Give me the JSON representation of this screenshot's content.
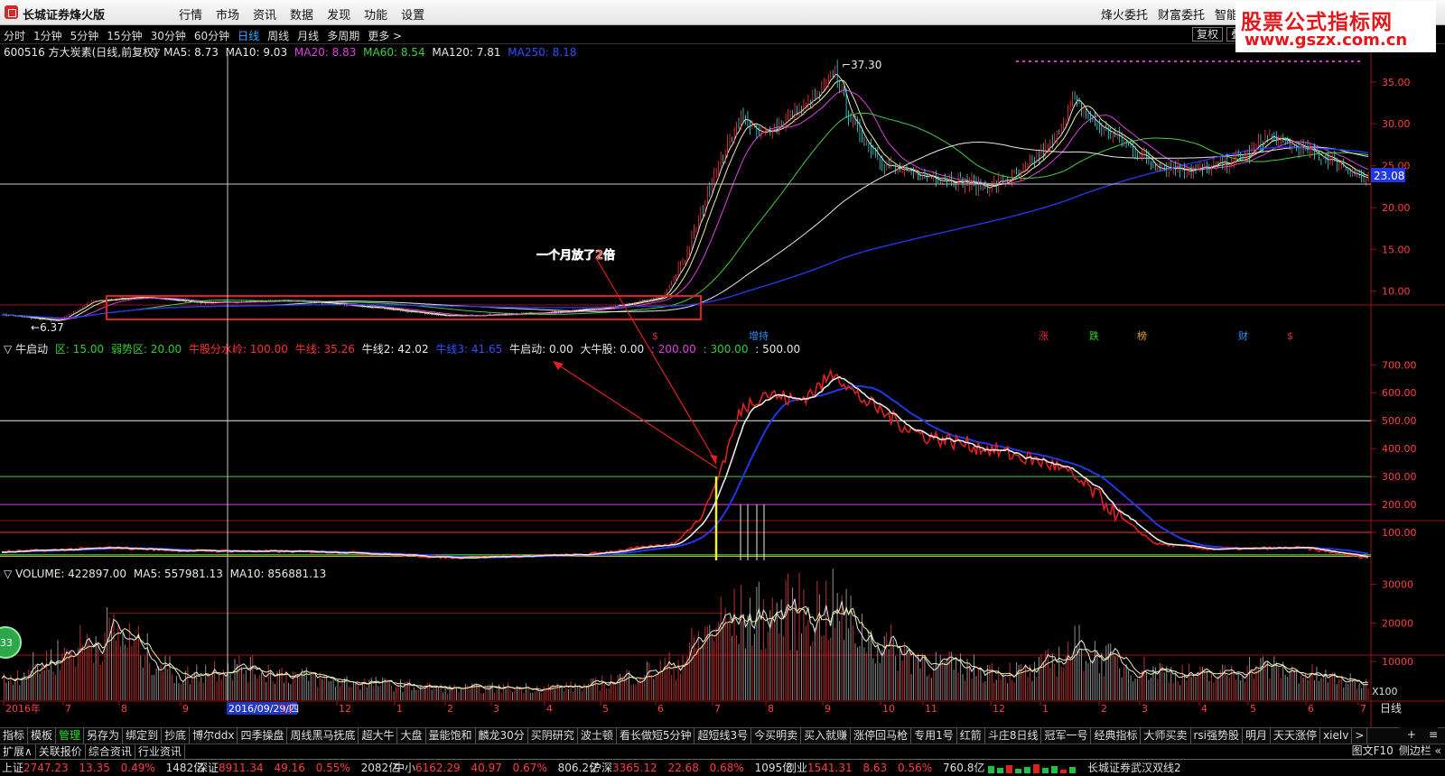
{
  "window": {
    "title": "长城证券烽火版",
    "menu": [
      "行情",
      "市场",
      "资讯",
      "数据",
      "发现",
      "功能",
      "设置"
    ],
    "right_menu": [
      "烽火委托",
      "财富委托",
      "智能客"
    ]
  },
  "watermark": {
    "line1": "股票公式指标网",
    "line2": "www.gszx.com.cn"
  },
  "periods": [
    "分时",
    "1分钟",
    "5分钟",
    "15分钟",
    "30分钟",
    "60分钟",
    "日线",
    "周线",
    "月线",
    "多周期",
    "更多 >"
  ],
  "active_period": "日线",
  "toolbar_right": [
    "复权",
    "叠"
  ],
  "price_panel": {
    "stock": "600516 方大炭素(日线,前复权)",
    "ma_labels": [
      {
        "text": "MA5: 8.73",
        "color": "#e8e8e8"
      },
      {
        "text": "MA10: 9.03",
        "color": "#e8e8e8"
      },
      {
        "text": "MA20: 8.83",
        "color": "#e040e0"
      },
      {
        "text": "MA60: 8.54",
        "color": "#40d040"
      },
      {
        "text": "MA120: 7.81",
        "color": "#e8e8e8"
      },
      {
        "text": "MA250: 8.18",
        "color": "#3050ff"
      }
    ],
    "y_ticks": [
      "35.00",
      "30.00",
      "25.00",
      "20.00",
      "15.00",
      "10.00"
    ],
    "high_label": "37.30",
    "low_label": "6.37",
    "current_price": "23.08",
    "annotation": "一个月放了2倍",
    "event_labels": [
      {
        "text": "$",
        "color": "#e03030"
      },
      {
        "text": "增持",
        "color": "#3090ff"
      },
      {
        "text": "涨",
        "color": "#e03030"
      },
      {
        "text": "跌",
        "color": "#30d030"
      },
      {
        "text": "榜",
        "color": "#e0a030"
      },
      {
        "text": "财",
        "color": "#3090ff"
      },
      {
        "text": "$",
        "color": "#e03030"
      }
    ]
  },
  "indicator_panel": {
    "name": "牛启动",
    "labels": [
      {
        "text": "区: 15.00",
        "color": "#30d030"
      },
      {
        "text": "弱势区: 20.00",
        "color": "#30d030"
      },
      {
        "text": "牛股分水岭: 100.00",
        "color": "#ff3030"
      },
      {
        "text": "牛线: 35.26",
        "color": "#ff3030"
      },
      {
        "text": "牛线2: 42.02",
        "color": "#e8e8e8"
      },
      {
        "text": "牛线3: 41.65",
        "color": "#3050ff"
      },
      {
        "text": "牛启动: 0.00",
        "color": "#e8e8e8"
      },
      {
        "text": "大牛股: 0.00",
        "color": "#e8e8e8"
      },
      {
        "text": ": 200.00",
        "color": "#e040e0"
      },
      {
        "text": ": 300.00",
        "color": "#30d030"
      },
      {
        "text": ": 500.00",
        "color": "#e8e8e8"
      }
    ],
    "y_ticks": [
      "700.00",
      "600.00",
      "500.00",
      "400.00",
      "300.00",
      "200.00",
      "100.00"
    ]
  },
  "volume_panel": {
    "labels": [
      {
        "text": "VOLUME: 422897.00",
        "color": "#e8e8e8"
      },
      {
        "text": "MA5: 557981.13",
        "color": "#e8e8e8"
      },
      {
        "text": "MA10: 856881.13",
        "color": "#e8e8e8"
      }
    ],
    "y_ticks": [
      "30000",
      "20000",
      "10000"
    ],
    "unit": "X100",
    "badge": "33"
  },
  "x_axis": {
    "labels": [
      "2016年",
      "7",
      "8",
      "9",
      "10",
      "11",
      "12",
      "1",
      "2",
      "3",
      "4",
      "5",
      "6",
      "7",
      "8",
      "9",
      "10",
      "11",
      "12",
      "1",
      "2",
      "3",
      "4",
      "5",
      "6",
      "7"
    ],
    "cursor_date": "2016/09/29/四",
    "period": "日线"
  },
  "formula_tabs": [
    "指标",
    "模板",
    "管理",
    "另存为",
    "绑定到",
    "抄底",
    "博尔ddx",
    "四季操盘",
    "周线黑马抚底",
    "超大牛",
    "大盘",
    "量能饱和",
    "麟龙30分",
    "买阴研究",
    "波士顿",
    "看长做短5分钟",
    "超短线3号",
    "今买明卖",
    "买入就赚",
    "涨停回马枪",
    "专用1号",
    "红箭",
    "斗庄8日线",
    "冠军一号",
    "经典指标",
    "大师买卖",
    "rsi强势股",
    "明月",
    "天天涨停",
    "xielv",
    ">"
  ],
  "active_formula": "管理",
  "formula_right": [
    "+",
    "≡"
  ],
  "info_tabs": [
    "扩展∧",
    "关联报价",
    "综合资讯",
    "行业资讯"
  ],
  "info_right": [
    "图文F10",
    "侧边栏 «"
  ],
  "status": {
    "indices": [
      {
        "name": "上证",
        "value": "2747.23",
        "change": "13.35",
        "pct": "0.49%",
        "amount": "1482亿"
      },
      {
        "name": "深证",
        "value": "8911.34",
        "change": "49.16",
        "pct": "0.55%",
        "amount": "2082亿"
      },
      {
        "name": "中小",
        "value": "6162.29",
        "change": "40.97",
        "pct": "0.67%",
        "amount": "806.2亿"
      },
      {
        "name": "沪深",
        "value": "3365.12",
        "change": "22.68",
        "pct": "0.68%",
        "amount": "1095亿"
      },
      {
        "name": "创业",
        "value": "1541.31",
        "change": "8.63",
        "pct": "0.56%",
        "amount": "760.8亿"
      }
    ],
    "text": "长城证券武汉双线2"
  },
  "colors": {
    "up": "#ff3c3c",
    "down": "#30d030",
    "ma250": "#2038e8",
    "grid_red": "#a01010",
    "cursor": "#c8c8c8"
  }
}
